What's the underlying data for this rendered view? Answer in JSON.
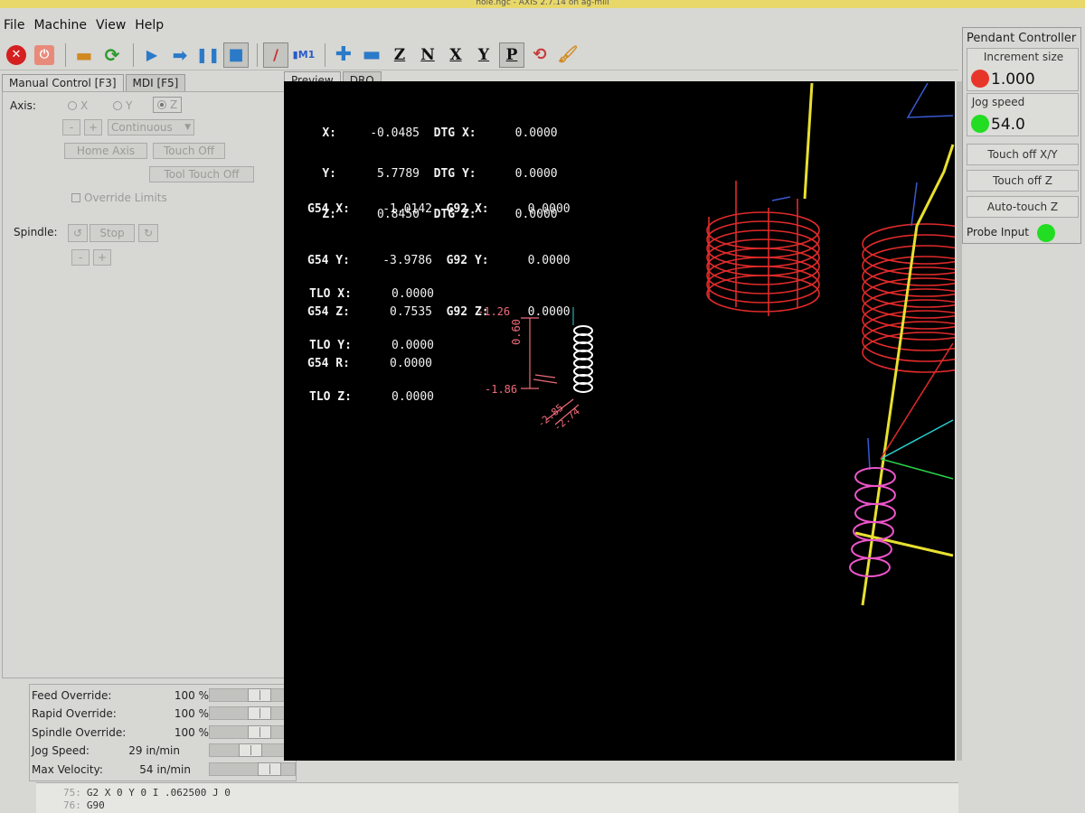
{
  "window": {
    "title": "hole.ngc - AXIS 2.7.14 on ag-mill"
  },
  "menu": [
    "File",
    "Machine",
    "View",
    "Help"
  ],
  "tabs_left": [
    "Manual Control [F3]",
    "MDI [F5]"
  ],
  "manual": {
    "axis_label": "Axis:",
    "axes": [
      "X",
      "Y",
      "Z"
    ],
    "selected_axis": "Z",
    "minus": "-",
    "plus": "+",
    "jog_mode": "Continuous",
    "home_axis": "Home Axis",
    "touch_off": "Touch Off",
    "tool_touch_off": "Tool Touch Off",
    "override_limits": "Override Limits",
    "spindle_label": "Spindle:",
    "spindle_stop": "Stop"
  },
  "overrides": [
    {
      "name": "Feed Override:",
      "value": "100 %",
      "fill": 0.6
    },
    {
      "name": "Rapid Override:",
      "value": "100 %",
      "fill": 0.6
    },
    {
      "name": "Spindle Override:",
      "value": "100 %",
      "fill": 0.6
    },
    {
      "name": "Jog Speed:",
      "value": "29 in/min",
      "fill": 0.45
    },
    {
      "name": "Max Velocity:",
      "value": "54 in/min",
      "fill": 0.75
    }
  ],
  "tabs_preview": [
    "Preview",
    "DRO"
  ],
  "dro": {
    "pos": [
      {
        "label": "X:",
        "value": "-0.0485",
        "dtg_label": "DTG X:",
        "dtg": "0.0000"
      },
      {
        "label": "Y:",
        "value": "5.7789",
        "dtg_label": "DTG Y:",
        "dtg": "0.0000"
      },
      {
        "label": "Z:",
        "value": "0.8450",
        "dtg_label": "DTG Z:",
        "dtg": "0.0000"
      }
    ],
    "g54": [
      {
        "label": "G54 X:",
        "value": "-1.0142",
        "g92_label": "G92 X:",
        "g92": "0.0000"
      },
      {
        "label": "G54 Y:",
        "value": "-3.9786",
        "g92_label": "G92 Y:",
        "g92": "0.0000"
      },
      {
        "label": "G54 Z:",
        "value": "0.7535",
        "g92_label": "G92 Z:",
        "g92": "0.0000"
      },
      {
        "label": "G54 R:",
        "value": "0.0000"
      }
    ],
    "tlo": [
      {
        "label": "TLO X:",
        "value": "0.0000"
      },
      {
        "label": "TLO Y:",
        "value": "0.0000"
      },
      {
        "label": "TLO Z:",
        "value": "0.0000"
      }
    ]
  },
  "preview_dims": {
    "top": "-1.26",
    "height": "0.60",
    "bottom": "-1.86",
    "diag1": "-2.85",
    "diag2": "-2.74"
  },
  "pendant": {
    "title": "Pendant Controller",
    "increment_label": "Increment size",
    "increment_value": "1.000",
    "increment_led": "#e8352a",
    "jog_label": "Jog speed",
    "jog_value": "54.0",
    "jog_led": "#22dd22",
    "touch_xy": "Touch off X/Y",
    "touch_z": "Touch off Z",
    "auto_touch_z": "Auto-touch Z",
    "probe_label": "Probe Input",
    "probe_led": "#22dd22"
  },
  "gcode": [
    {
      "num": "75:",
      "text": "G2 X 0 Y 0 I .062500 J 0"
    },
    {
      "num": "76:",
      "text": "G90"
    }
  ],
  "colors": {
    "toolpath_feed": "#e02a2a",
    "toolpath_rapid": "#e8e030",
    "dims": "#f06a7a",
    "spiral_white": "#ffffff",
    "spiral_pink": "#ee55cc"
  }
}
